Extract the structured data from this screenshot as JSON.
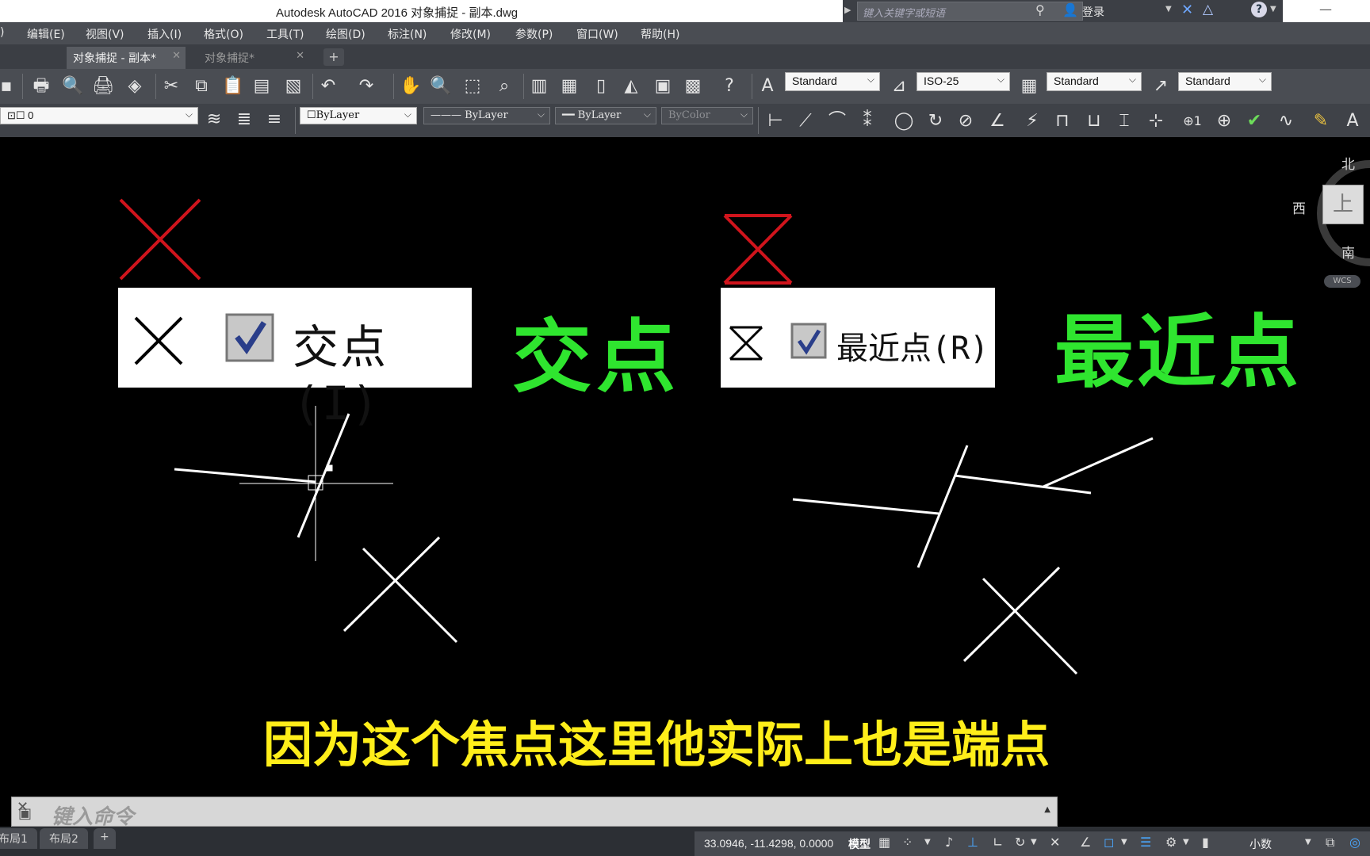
{
  "window": {
    "title": "Autodesk AutoCAD 2016    对象捕捉 - 副本.dwg",
    "search_placeholder": "键入关键字或短语",
    "login": "登录"
  },
  "menu": [
    "编辑(E)",
    "视图(V)",
    "插入(I)",
    "格式(O)",
    "工具(T)",
    "绘图(D)",
    "标注(N)",
    "修改(M)",
    "参数(P)",
    "窗口(W)",
    "帮助(H)"
  ],
  "tabs": [
    {
      "label": "对象捕捉 - 副本*",
      "active": true
    },
    {
      "label": "对象捕捉*",
      "active": false
    }
  ],
  "toolbar": {
    "text_style": "Standard",
    "dim_style": "ISO-25",
    "table_style": "Standard",
    "mleader_style": "Standard",
    "layer": "0",
    "color": "ByLayer",
    "linetype": "ByLayer",
    "lineweight": "ByLayer",
    "plotstyle": "ByColor"
  },
  "canvas": {
    "panel_left_label": "交点(I)",
    "panel_left_checked": true,
    "big_left": "交点",
    "panel_right_label": "最近点(R)",
    "panel_right_checked": true,
    "big_right": "最近点",
    "subtitle": "因为这个焦点这里他实际上也是端点",
    "accent_green": "#2fe52f",
    "subtitle_yellow": "#ffee1a",
    "marker_red": "#d0141c"
  },
  "viewcube": {
    "north": "北",
    "west": "西",
    "south": "南",
    "face": "上",
    "wcs": "WCS"
  },
  "command": {
    "placeholder": "键入命令"
  },
  "layouts": [
    "布局1",
    "布局2"
  ],
  "status": {
    "coords": "33.0946, -11.4298, 0.0000",
    "model": "模型",
    "units": "小数"
  }
}
